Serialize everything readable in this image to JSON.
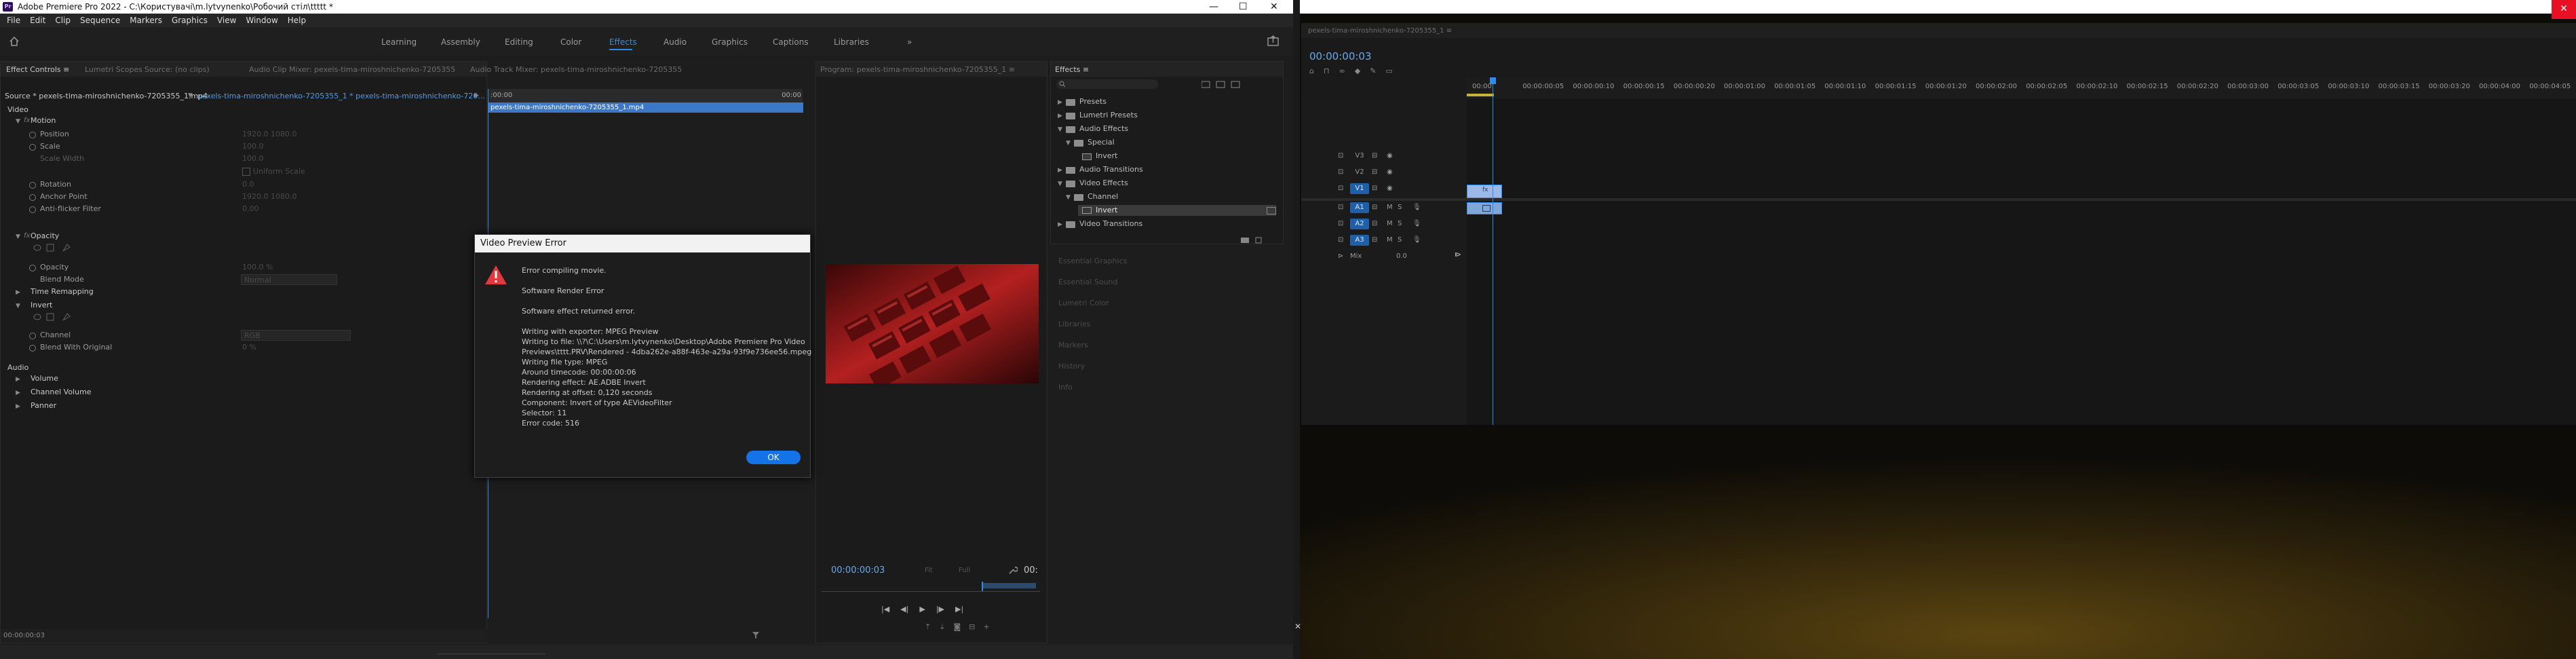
{
  "left_window": {
    "title": "Adobe Premiere Pro 2022 - C:\\Користувачі\\m.lytvynenko\\Робочий стіл\\ttttt *",
    "logo": "Pr",
    "window_controls": {
      "minimize": "—",
      "maximize": "☐",
      "close": "✕"
    },
    "menu": [
      "File",
      "Edit",
      "Clip",
      "Sequence",
      "Markers",
      "Graphics",
      "View",
      "Window",
      "Help"
    ],
    "workspaces": [
      "Learning",
      "Assembly",
      "Editing",
      "Color",
      "Effects",
      "Audio",
      "Graphics",
      "Captions",
      "Libraries"
    ],
    "workspaces_more": "»",
    "accent": "#2d8ceb"
  },
  "effect_controls": {
    "tabs": [
      "Effect Controls ≡",
      "Lumetri Scopes",
      "Source: (no clips)",
      "Audio Clip Mixer: pexels-tima-miroshnichenko-7205355",
      "Audio Track Mixer: pexels-tima-miroshnichenko-7205355"
    ],
    "source_line": "Source * pexels-tima-miroshnichenko-7205355_1.mp4",
    "sequence_line": "pexels-tima-miroshnichenko-7205355_1 * pexels-tima-miroshnichenko-720...",
    "mini_clip_label": "pexels-tima-miroshnichenko-7205355_1.mp4",
    "mini_ruler": {
      "start": ":00:00",
      "end": "00:00"
    },
    "video_section": "Video",
    "motion": {
      "name": "Motion",
      "position": {
        "label": "Position",
        "values": "1920.0   1080.0"
      },
      "scale": {
        "label": "Scale",
        "value": "100.0"
      },
      "scale_width": {
        "label": "Scale Width",
        "value": "100.0"
      },
      "uniform_scale": "Uniform Scale",
      "rotation": {
        "label": "Rotation",
        "value": "0.0"
      },
      "anchor_point": {
        "label": "Anchor Point",
        "values": "1920.0   1080.0"
      },
      "anti_flicker": {
        "label": "Anti-flicker Filter",
        "value": "0.00"
      }
    },
    "opacity": {
      "name": "Opacity",
      "opacity": {
        "label": "Opacity",
        "value": "100.0 %"
      },
      "blend_mode": {
        "label": "Blend Mode",
        "value": "Normal"
      }
    },
    "time_remapping": "Time Remapping",
    "invert": {
      "name": "Invert",
      "channel": {
        "label": "Channel",
        "value": "RGB"
      },
      "blend": {
        "label": "Blend With Original",
        "value": "0 %"
      }
    },
    "audio_section": "Audio",
    "audio_items": [
      "Volume",
      "Channel Volume",
      "Panner"
    ],
    "timecode": "00:00:00:03"
  },
  "program_monitor": {
    "tab": "Program: pexels-tima-miroshnichenko-7205355_1 ≡",
    "timecode": "00:00:00:03",
    "fit": "Fit",
    "quality": "Full",
    "duration": "00:"
  },
  "dialog": {
    "title": "Video Preview Error",
    "lines": [
      "Error compiling movie.",
      "",
      "Software Render Error",
      "",
      "Software effect returned error.",
      "",
      "Writing with exporter: MPEG Preview",
      "Writing to file: \\\\?\\C:\\Users\\m.lytvynenko\\Desktop\\Adobe Premiere Pro Video",
      "Previews\\tttt.PRV\\Rendered - 4dba262e-a88f-463e-a29a-93f9e736ee56.mpeg",
      "Writing file type: MPEG",
      "Around timecode: 00:00:00:06",
      "Rendering effect: AE.ADBE Invert",
      "Rendering at offset: 0,120 seconds",
      "Component: Invert of type AEVideoFilter",
      "Selector: 11",
      "Error code: 516"
    ],
    "ok": "OK",
    "warning_color": "#e0393e"
  },
  "effects_panel": {
    "tab": "Effects ≡",
    "search_placeholder": "",
    "tree": [
      {
        "label": "Presets",
        "level": 0,
        "icon": "folder"
      },
      {
        "label": "Lumetri Presets",
        "level": 0,
        "icon": "folder"
      },
      {
        "label": "Audio Effects",
        "level": 0,
        "icon": "folder"
      },
      {
        "label": "Special",
        "level": 1,
        "icon": "folder"
      },
      {
        "label": "Invert",
        "level": 2,
        "icon": "effect"
      },
      {
        "label": "Audio Transitions",
        "level": 0,
        "icon": "folder"
      },
      {
        "label": "Video Effects",
        "level": 0,
        "icon": "folder"
      },
      {
        "label": "Channel",
        "level": 1,
        "icon": "folder"
      },
      {
        "label": "Invert",
        "level": 2,
        "icon": "effect",
        "selected": true
      },
      {
        "label": "Video Transitions",
        "level": 0,
        "icon": "folder"
      }
    ],
    "collapsed": [
      "Essential Graphics",
      "Essential Sound",
      "Lumetri Color",
      "Libraries",
      "Markers",
      "History",
      "Info"
    ]
  },
  "timeline": {
    "sequence_tab": "pexels-tima-miroshnichenko-7205355_1 ≡",
    "timecode": "00:00:00:03",
    "ruler": [
      "00:00",
      "00:00:00:05",
      "00:00:00:10",
      "00:00:00:15",
      "00:00:00:20",
      "00:00:01:00",
      "00:00:01:05",
      "00:00:01:10",
      "00:00:01:15",
      "00:00:01:20",
      "00:00:02:00",
      "00:00:02:05",
      "00:00:02:10",
      "00:00:02:15",
      "00:00:02:20",
      "00:00:03:00",
      "00:00:03:05",
      "00:00:03:10",
      "00:00:03:15",
      "00:00:03:20",
      "00:00:04:00",
      "00:00:04:05"
    ],
    "video_tracks": [
      "V3",
      "V2",
      "V1"
    ],
    "audio_tracks": [
      "A1",
      "A2",
      "A3"
    ],
    "mix": "Mix",
    "mix_value": "0.0",
    "clip_fx_label": "fx"
  }
}
